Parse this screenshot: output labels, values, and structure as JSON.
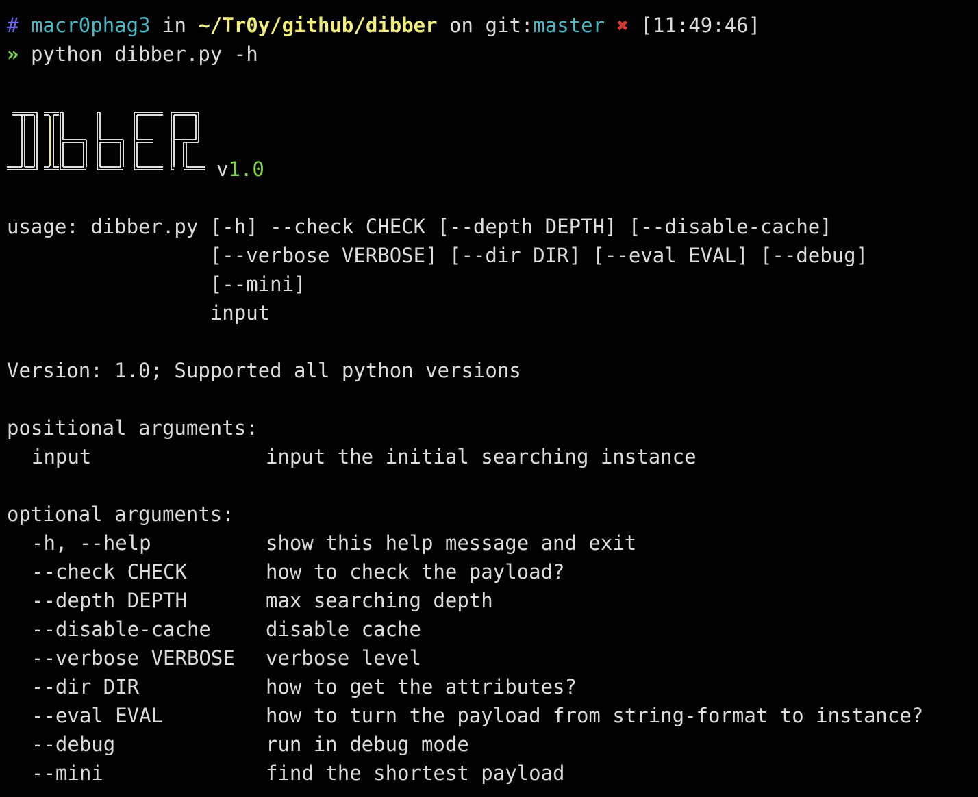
{
  "prompt": {
    "hash": "#",
    "user": "macr0phag3",
    "in": "in",
    "path": "~/Tr0y/github/dibber",
    "on": "on",
    "git_label": "git:",
    "branch": "master",
    "dirty_mark": "✖",
    "time": "[11:49:46]",
    "arrow": "»",
    "command": "python dibber.py -h"
  },
  "banner": {
    "logo_text": "DIBBER",
    "version_prefix": "v",
    "version_number": "1.0"
  },
  "usage": {
    "lines": [
      "usage: dibber.py [-h] --check CHECK [--depth DEPTH] [--disable-cache]",
      "                 [--verbose VERBOSE] [--dir DIR] [--eval EVAL] [--debug]",
      "                 [--mini]",
      "                 input"
    ]
  },
  "description": "Version: 1.0; Supported all python versions",
  "positional": {
    "heading": "positional arguments:",
    "args": [
      {
        "flag": "input",
        "desc": "input the initial searching instance"
      }
    ]
  },
  "optional": {
    "heading": "optional arguments:",
    "args": [
      {
        "flag": "-h, --help",
        "desc": "show this help message and exit"
      },
      {
        "flag": "--check CHECK",
        "desc": "how to check the payload?"
      },
      {
        "flag": "--depth DEPTH",
        "desc": "max searching depth"
      },
      {
        "flag": "--disable-cache",
        "desc": "disable cache"
      },
      {
        "flag": "--verbose VERBOSE",
        "desc": "verbose level"
      },
      {
        "flag": "--dir DIR",
        "desc": "how to get the attributes?"
      },
      {
        "flag": "--eval EVAL",
        "desc": "how to turn the payload from string-format to instance?"
      },
      {
        "flag": "--debug",
        "desc": "run in debug mode"
      },
      {
        "flag": "--mini",
        "desc": "find the shortest payload"
      }
    ]
  },
  "colors": {
    "background": "#000000",
    "foreground": "#dcdcdc",
    "hash": "#6e6cf5",
    "user": "#48b8c4",
    "path": "#f1ee7c",
    "branch": "#48b8c4",
    "dirty": "#d33a2f",
    "arrow": "#7ad647",
    "version": "#7ad647"
  }
}
